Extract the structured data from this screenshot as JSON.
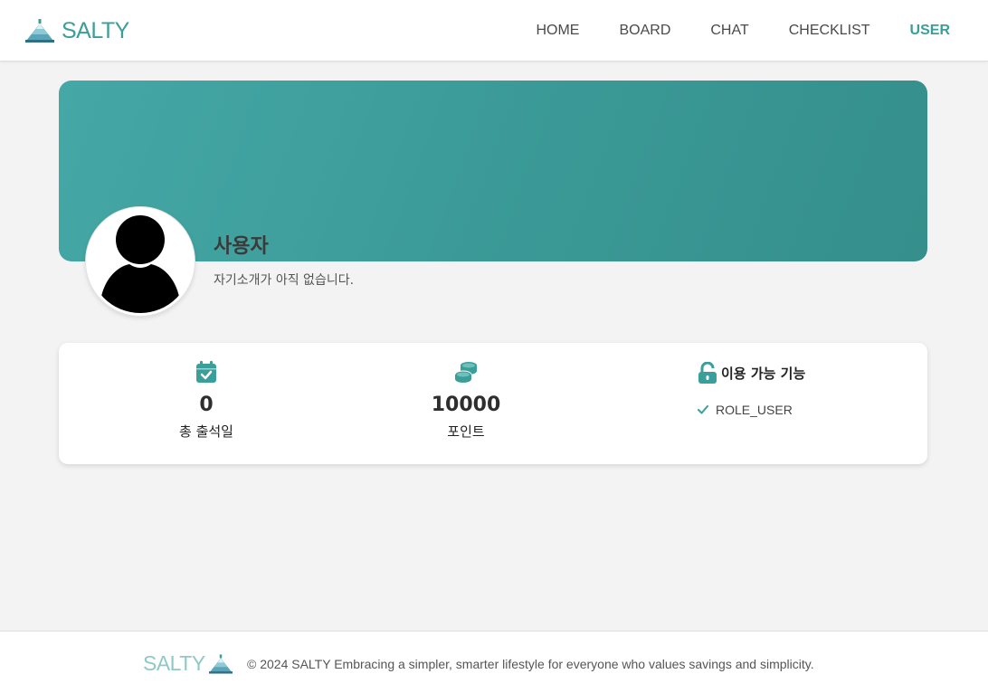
{
  "header": {
    "logo_text": "SALTY",
    "nav": [
      {
        "label": "HOME",
        "active": false
      },
      {
        "label": "BOARD",
        "active": false
      },
      {
        "label": "CHAT",
        "active": false
      },
      {
        "label": "CHECKLIST",
        "active": false
      },
      {
        "label": "USER",
        "active": true
      }
    ]
  },
  "profile": {
    "name": "사용자",
    "intro": "자기소개가 아직 없습니다."
  },
  "stats": {
    "attendance": {
      "value": "0",
      "label": "총 출석일",
      "icon": "calendar-check-icon"
    },
    "points": {
      "value": "10000",
      "label": "포인트",
      "icon": "coins-icon"
    },
    "features": {
      "title": "이용 가능 기능",
      "icon": "unlock-icon",
      "items": [
        "ROLE_USER"
      ]
    }
  },
  "footer": {
    "logo_text": "SALTY",
    "copyright": "© 2024 SALTY Embracing a simpler, smarter lifestyle for everyone who values savings and simplicity."
  },
  "colors": {
    "accent": "#3a9e9a",
    "banner": "#3d9f9c",
    "background": "#f3f3f3"
  }
}
